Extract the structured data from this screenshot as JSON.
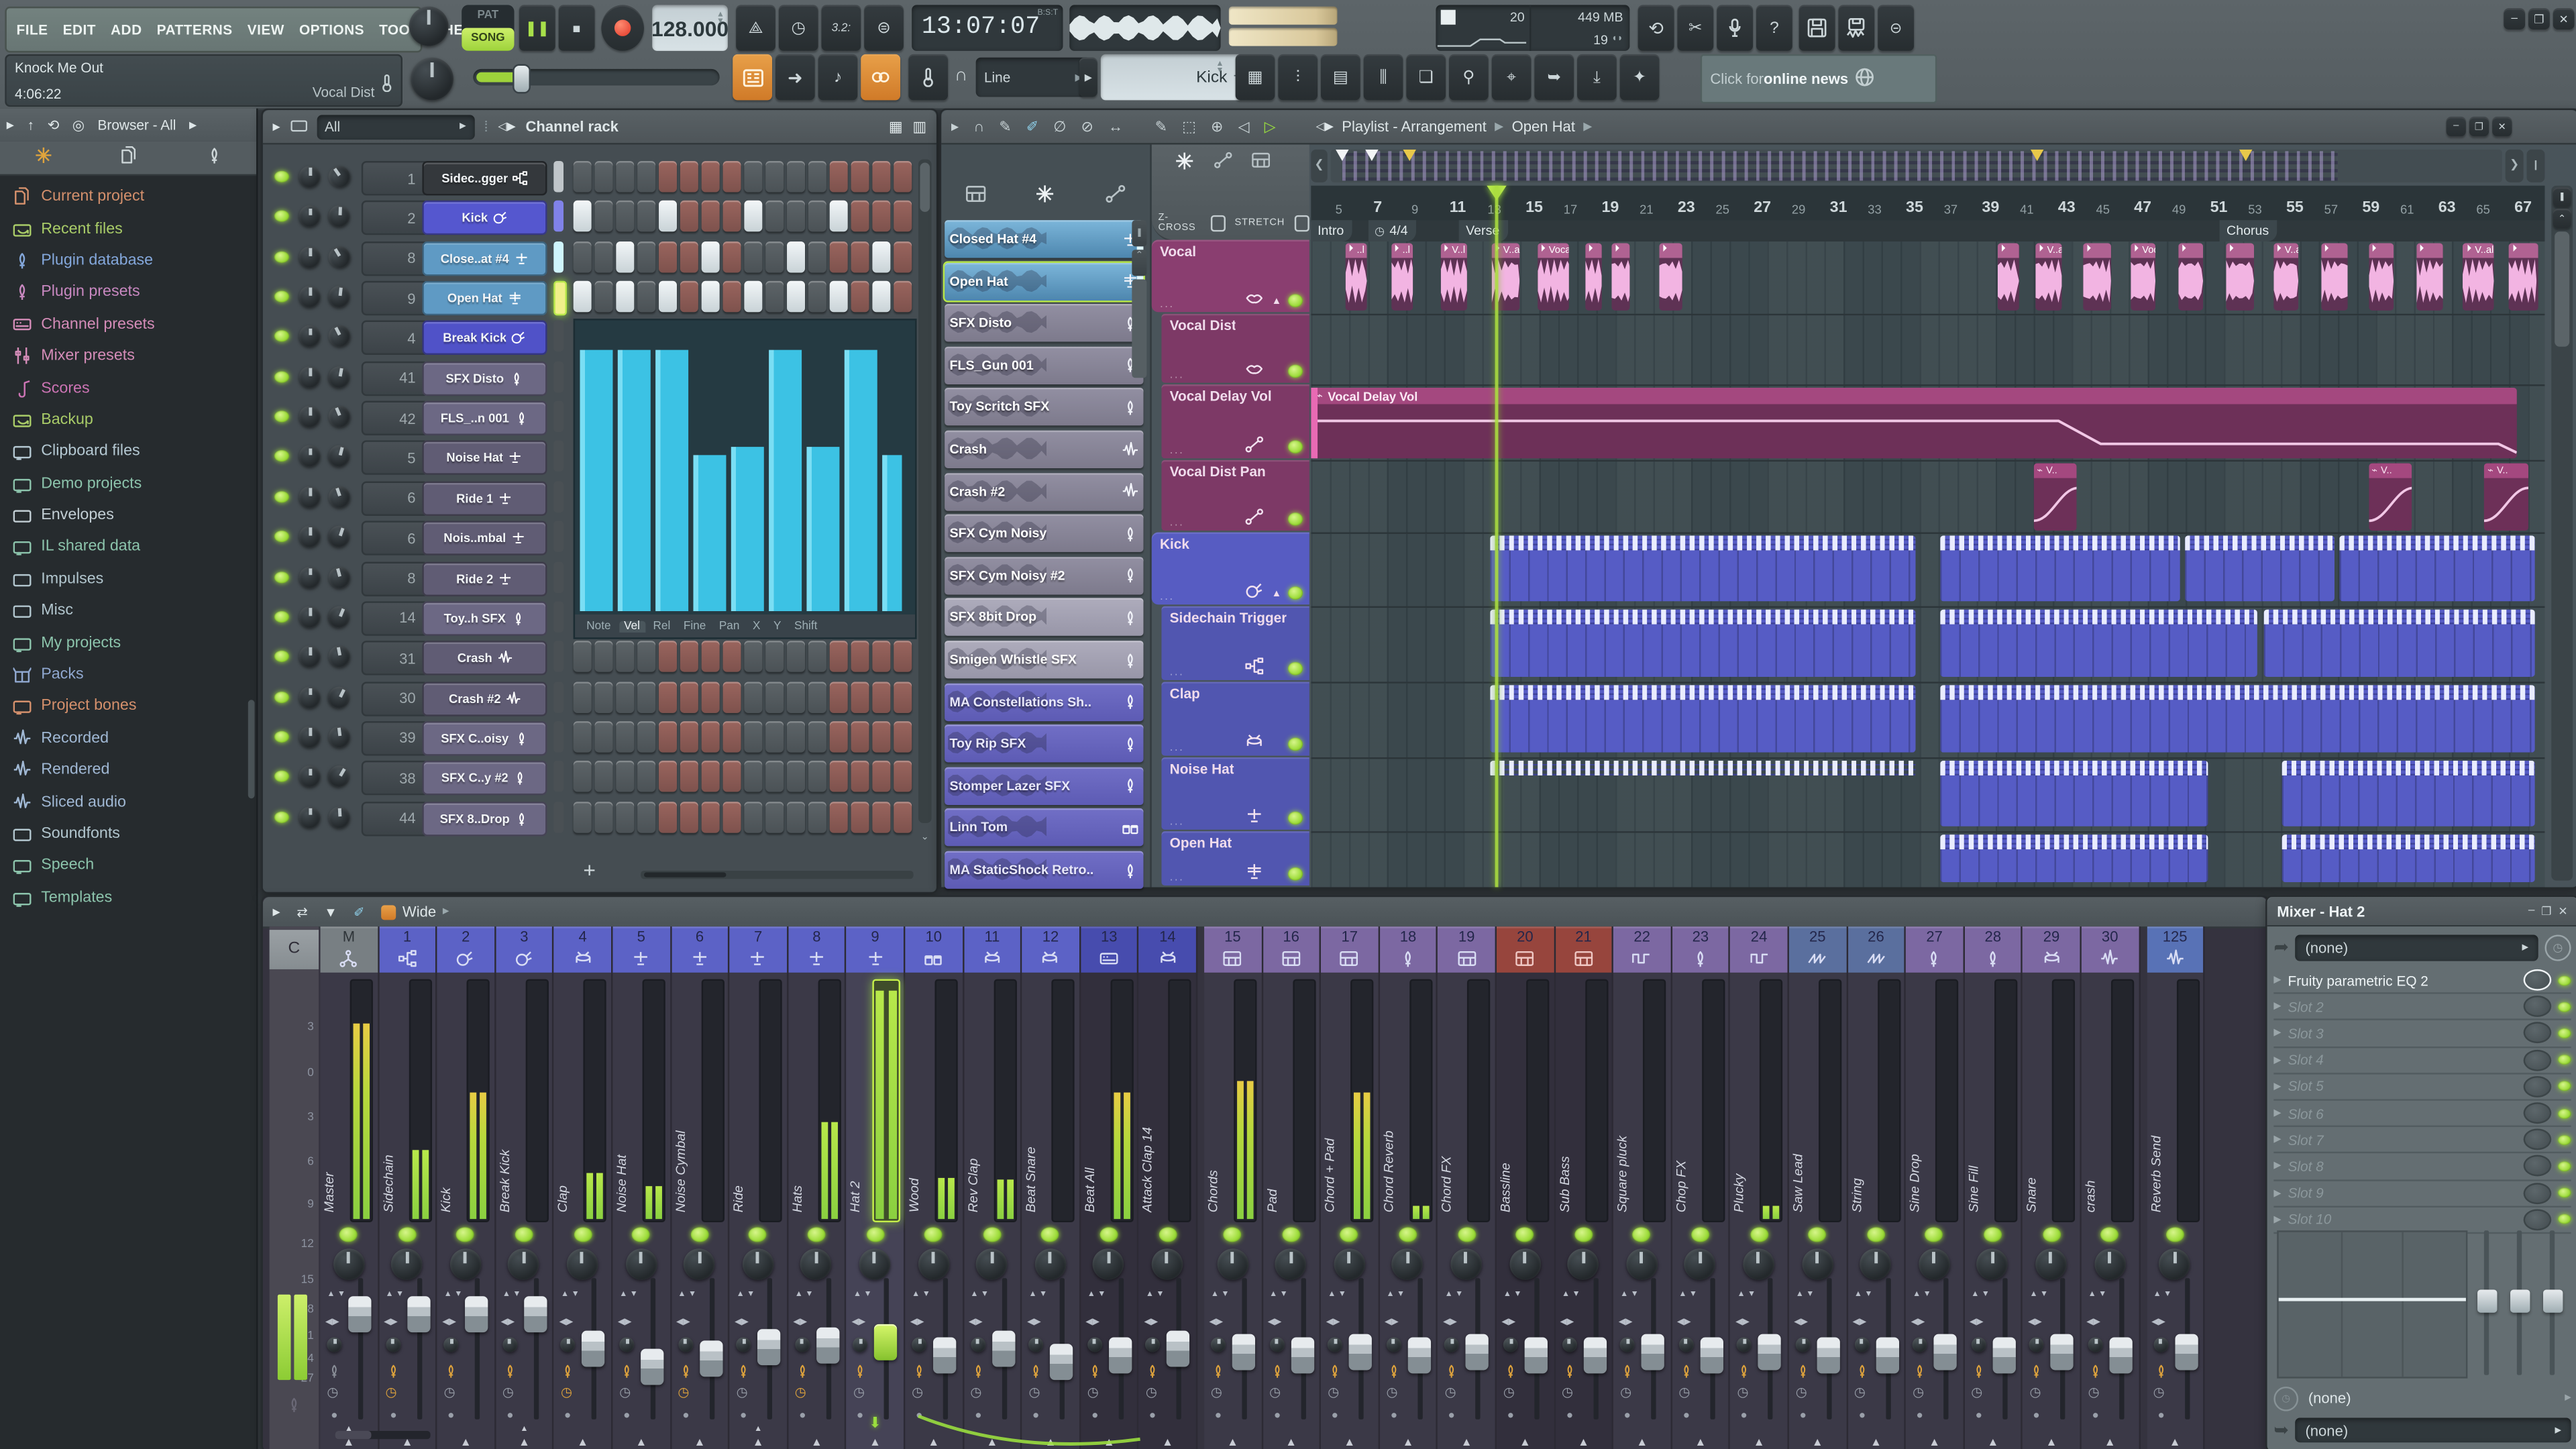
{
  "top": {
    "menu": [
      "FILE",
      "EDIT",
      "ADD",
      "PATTERNS",
      "VIEW",
      "OPTIONS",
      "TOOLS",
      "HELP"
    ],
    "transport": {
      "pat": "PAT",
      "song": "SONG",
      "bpm": "128.000",
      "time": "13:07:07",
      "time_mode": "B:S:T",
      "cpu_pct": "20",
      "mem": "449 MB",
      "polyphony": "19"
    },
    "project": {
      "name": "Knock Me Out",
      "time": "4:06:22",
      "focus": "Vocal Dist"
    },
    "snap": "Line",
    "pattern_selector": "Kick",
    "news_pre": "Click for ",
    "news_bold": "online news"
  },
  "browser": {
    "title": "Browser - All",
    "items": [
      {
        "label": "Current project",
        "icon": "docs",
        "color": "#d4906c"
      },
      {
        "label": "Recent files",
        "icon": "folderarrow",
        "color": "#a9cc68"
      },
      {
        "label": "Plugin database",
        "icon": "plug",
        "color": "#84a8dc"
      },
      {
        "label": "Plugin presets",
        "icon": "plug",
        "color": "#c888c0"
      },
      {
        "label": "Channel presets",
        "icon": "machine",
        "color": "#d48cb8"
      },
      {
        "label": "Mixer presets",
        "icon": "mix",
        "color": "#d48cb8"
      },
      {
        "label": "Scores",
        "icon": "note",
        "color": "#cc74b4"
      },
      {
        "label": "Backup",
        "icon": "folderarrow",
        "color": "#a9cc68"
      },
      {
        "label": "Clipboard files",
        "icon": "folderplus",
        "color": "#b4c8d2"
      },
      {
        "label": "Demo projects",
        "icon": "folderplus",
        "color": "#8cc4ac"
      },
      {
        "label": "Envelopes",
        "icon": "folder",
        "color": "#c2ced4"
      },
      {
        "label": "IL shared data",
        "icon": "folderplus",
        "color": "#8cc4ac"
      },
      {
        "label": "Impulses",
        "icon": "folder",
        "color": "#b2c6ce"
      },
      {
        "label": "Misc",
        "icon": "folder",
        "color": "#b2c6ce"
      },
      {
        "label": "My projects",
        "icon": "folderplus",
        "color": "#8cc4ac"
      },
      {
        "label": "Packs",
        "icon": "box",
        "color": "#90a8d0"
      },
      {
        "label": "Project bones",
        "icon": "folderplus",
        "color": "#d4906c"
      },
      {
        "label": "Recorded",
        "icon": "wave",
        "color": "#a0b8d4"
      },
      {
        "label": "Rendered",
        "icon": "wave",
        "color": "#a0b8d4"
      },
      {
        "label": "Sliced audio",
        "icon": "wave",
        "color": "#a0b8d4"
      },
      {
        "label": "Soundfonts",
        "icon": "folder",
        "color": "#b2c6ce"
      },
      {
        "label": "Speech",
        "icon": "folderplus",
        "color": "#8cc4ac"
      },
      {
        "label": "Templates",
        "icon": "folderplus",
        "color": "#8cc4ac"
      }
    ]
  },
  "rack": {
    "filter": "All",
    "title": "Channel rack",
    "add": "+",
    "channels": [
      {
        "num": "1",
        "name": "Sidec..gger",
        "bg": "#34383c",
        "icon": "sidechain",
        "sel": "#c0c6ca"
      },
      {
        "num": "2",
        "name": "Kick",
        "bg": "#5557cf",
        "icon": "kick",
        "sel": "#8082e8"
      },
      {
        "num": "8",
        "name": "Close..at #4",
        "bg": "#5f9ac4",
        "icon": "hat",
        "sel": "#cff4fc"
      },
      {
        "num": "9",
        "name": "Open Hat",
        "bg": "#5f9ac4",
        "icon": "hatopen",
        "sel": "#f0f08a",
        "selected": true
      },
      {
        "num": "4",
        "name": "Break Kick",
        "bg": "#5052c8",
        "icon": "kick",
        "sel": "#4a5054"
      },
      {
        "num": "41",
        "name": "SFX Disto",
        "bg": "#6c6884",
        "icon": "plug",
        "sel": "#4a5054"
      },
      {
        "num": "42",
        "name": "FLS_..n 001",
        "bg": "#6c6884",
        "icon": "plug",
        "sel": "#4a5054"
      },
      {
        "num": "5",
        "name": "Noise Hat",
        "bg": "#605c74",
        "icon": "hat",
        "sel": "#4a5054"
      },
      {
        "num": "6",
        "name": "Ride 1",
        "bg": "#605c74",
        "icon": "hat",
        "sel": "#4a5054"
      },
      {
        "num": "6",
        "name": "Nois..mbal",
        "bg": "#605c74",
        "icon": "hat",
        "sel": "#4a5054"
      },
      {
        "num": "8",
        "name": "Ride 2",
        "bg": "#605c74",
        "icon": "hat",
        "sel": "#4a5054"
      },
      {
        "num": "14",
        "name": "Toy..h SFX",
        "bg": "#6c6884",
        "icon": "plug",
        "sel": "#4a5054"
      },
      {
        "num": "31",
        "name": "Crash",
        "bg": "#605c74",
        "icon": "wave",
        "sel": "#4a5054"
      },
      {
        "num": "30",
        "name": "Crash #2",
        "bg": "#605c74",
        "icon": "wave",
        "sel": "#4a5054"
      },
      {
        "num": "39",
        "name": "SFX C..oisy",
        "bg": "#6c6884",
        "icon": "plug",
        "sel": "#4a5054"
      },
      {
        "num": "38",
        "name": "SFX C..y #2",
        "bg": "#6c6884",
        "icon": "plug",
        "sel": "#4a5054"
      },
      {
        "num": "44",
        "name": "SFX 8..Drop",
        "bg": "#6c6884",
        "icon": "plug",
        "sel": "#4a5054"
      }
    ],
    "steps_lit": {
      "1": [
        0,
        4,
        8,
        12
      ],
      "2": [
        2,
        6,
        10,
        14
      ],
      "3": [
        0,
        2,
        4,
        6,
        8,
        10,
        12,
        14
      ]
    },
    "graph": {
      "bars": [
        0.92,
        0.92,
        0.92,
        0.55,
        0.58,
        0.92,
        0.58,
        0.92,
        0.55
      ],
      "tabs": [
        "Note",
        "Vel",
        "Rel",
        "Fine",
        "Pan",
        "X",
        "Y",
        "Shift"
      ],
      "active_tab": "Vel"
    }
  },
  "picker": {
    "items": [
      {
        "name": "Closed Hat #4",
        "style": "blue",
        "icon": "hat"
      },
      {
        "name": "Open Hat",
        "style": "blue",
        "icon": "hatopen",
        "selected": true
      },
      {
        "name": "SFX Disto",
        "style": "gray",
        "icon": "plug"
      },
      {
        "name": "FLS_Gun 001",
        "style": "gray",
        "icon": "plug"
      },
      {
        "name": "Toy Scritch SFX",
        "style": "gray",
        "icon": "plug"
      },
      {
        "name": "Crash",
        "style": "gray",
        "icon": "wave"
      },
      {
        "name": "Crash #2",
        "style": "gray",
        "icon": "wave"
      },
      {
        "name": "SFX Cym Noisy",
        "style": "gray",
        "icon": "plug"
      },
      {
        "name": "SFX Cym Noisy #2",
        "style": "gray",
        "icon": "plug"
      },
      {
        "name": "SFX 8bit Drop",
        "style": "light",
        "icon": "plug"
      },
      {
        "name": "Smigen Whistle SFX",
        "style": "light",
        "icon": "plug"
      },
      {
        "name": "MA Constellations Sh..",
        "style": "purple",
        "icon": "plug"
      },
      {
        "name": "Toy Rip SFX",
        "style": "purple",
        "icon": "plug"
      },
      {
        "name": "Stomper Lazer SFX",
        "style": "purple",
        "icon": "plug"
      },
      {
        "name": "Linn Tom",
        "style": "purple",
        "icon": "toms"
      },
      {
        "name": "MA StaticShock Retro..",
        "style": "purple",
        "icon": "plug"
      }
    ]
  },
  "playlist": {
    "title": "Playlist - Arrangement",
    "crumb": "Open Hat",
    "toggle_zcross": "Z-CROSS",
    "toggle_stretch": "STRETCH",
    "ruler_start": 5,
    "ruler_end": 67,
    "playhead_bar": 13,
    "markers": [
      {
        "label": "Intro",
        "bar": 3.3
      },
      {
        "label": "4/4",
        "bar": 6.2,
        "clock": true
      },
      {
        "label": "Verse",
        "bar": 11
      },
      {
        "label": "Chorus",
        "bar": 51
      }
    ],
    "tracks": [
      {
        "name": "Vocal",
        "bg": "#8a3e70",
        "icon": "lips",
        "parent": true,
        "h": 45
      },
      {
        "name": "Vocal Dist",
        "bg": "#7d3966",
        "icon": "lips",
        "h": 43
      },
      {
        "name": "Vocal Delay Vol",
        "bg": "#7d3966",
        "icon": "auto",
        "h": 46
      },
      {
        "name": "Vocal Dist Pan",
        "bg": "#7d3966",
        "icon": "auto",
        "h": 44
      },
      {
        "name": "Kick",
        "bg": "#575cc2",
        "icon": "kick",
        "parent": true,
        "h": 45
      },
      {
        "name": "Sidechain Trigger",
        "bg": "#5156b0",
        "icon": "sidechain",
        "h": 46
      },
      {
        "name": "Clap",
        "bg": "#5156b0",
        "icon": "drum",
        "h": 46
      },
      {
        "name": "Noise Hat",
        "bg": "#5156b0",
        "icon": "hat",
        "h": 45
      },
      {
        "name": "Open Hat",
        "bg": "#5156b0",
        "icon": "hatopen",
        "h": 34
      }
    ],
    "vocal_clips": [
      {
        "b": 5.0,
        "w": 1.1,
        "l": "..l"
      },
      {
        "b": 7.4,
        "w": 1.2,
        "l": "..l"
      },
      {
        "b": 10.0,
        "w": 1.4,
        "l": "V..l"
      },
      {
        "b": 12.7,
        "w": 1.5,
        "l": "V..al"
      },
      {
        "b": 15.1,
        "w": 1.7,
        "l": "Vocal"
      },
      {
        "b": 17.6,
        "w": 0.9,
        "l": ""
      },
      {
        "b": 19.0,
        "w": 1.0,
        "l": ""
      },
      {
        "b": 21.5,
        "w": 1.2,
        "l": ""
      },
      {
        "b": 39.3,
        "w": 1.1,
        "l": ""
      },
      {
        "b": 41.3,
        "w": 1.4,
        "l": "V..al"
      },
      {
        "b": 43.8,
        "w": 1.5,
        "l": ""
      },
      {
        "b": 46.3,
        "w": 1.3,
        "l": "Vocal"
      },
      {
        "b": 48.8,
        "w": 1.3,
        "l": ""
      },
      {
        "b": 51.3,
        "w": 1.5,
        "l": ""
      },
      {
        "b": 53.8,
        "w": 1.3,
        "l": "V..al"
      },
      {
        "b": 56.3,
        "w": 1.4,
        "l": ""
      },
      {
        "b": 58.8,
        "w": 1.3,
        "l": ""
      },
      {
        "b": 61.3,
        "w": 1.4,
        "l": ""
      },
      {
        "b": 63.8,
        "w": 1.6,
        "l": "V..al"
      },
      {
        "b": 66.2,
        "w": 1.5,
        "l": ""
      }
    ],
    "automation_clip": {
      "label": "Vocal Delay Vol",
      "b0": 3.2,
      "b1": 66.6,
      "line": [
        [
          0,
          0.33
        ],
        [
          0.62,
          0.33
        ],
        [
          0.655,
          0.78
        ],
        [
          0.985,
          0.78
        ],
        [
          1,
          0.95
        ]
      ]
    },
    "pan_clips": [
      {
        "b": 41.2,
        "w": 2.3,
        "l": "V.."
      },
      {
        "b": 58.8,
        "w": 2.3,
        "l": "V.."
      },
      {
        "b": 64.9,
        "w": 2.3,
        "l": "V.."
      }
    ],
    "pattern_runs": {
      "kick": [
        [
          12.6,
          35.0
        ],
        [
          36.3,
          48.9
        ],
        [
          49.2,
          57.0
        ],
        [
          57.3,
          67.6
        ]
      ],
      "sidechain": [
        [
          12.6,
          35.0
        ],
        [
          36.3,
          53.0
        ],
        [
          53.3,
          67.6
        ]
      ],
      "clap": [
        [
          12.6,
          35.0
        ],
        [
          36.3,
          67.6
        ]
      ],
      "noisehat_ticks": [
        [
          12.6,
          35.0
        ]
      ],
      "noisehat": [
        [
          36.3,
          50.4
        ],
        [
          54.3,
          67.6
        ]
      ],
      "openhat": [
        [
          36.3,
          50.4
        ],
        [
          54.3,
          67.6
        ]
      ]
    }
  },
  "mixer": {
    "view": "Wide",
    "db_scale": [
      "3",
      "0",
      "3",
      "6",
      "9",
      "12",
      "15",
      "18",
      "21",
      "24",
      "27"
    ],
    "dock_label": "C",
    "strips": [
      {
        "num": "M",
        "name": "Master",
        "grp": "gray",
        "icon": "net",
        "meter": 0.85,
        "mcol": "yellow",
        "fader": 0.82,
        "route": true
      },
      {
        "num": "1",
        "name": "Sidechain",
        "grp": "blue",
        "icon": "sidechain",
        "meter": 0.3,
        "fader": 0.82
      },
      {
        "num": "2",
        "name": "Kick",
        "grp": "blue",
        "icon": "kick",
        "meter": 0.55,
        "mcol": "yellow",
        "fader": 0.82
      },
      {
        "num": "3",
        "name": "Break Kick",
        "grp": "blue",
        "icon": "kick",
        "meter": 0,
        "fader": 0.82,
        "route": true
      },
      {
        "num": "4",
        "name": "Clap",
        "grp": "blue",
        "icon": "drum",
        "meter": 0.2,
        "fader": 0.48
      },
      {
        "num": "5",
        "name": "Noise Hat",
        "grp": "blue",
        "icon": "hat",
        "meter": 0.14,
        "fader": 0.3
      },
      {
        "num": "6",
        "name": "Noise Cymbal",
        "grp": "blue",
        "icon": "hat",
        "meter": 0,
        "fader": 0.38
      },
      {
        "num": "7",
        "name": "Ride",
        "grp": "blue",
        "icon": "hat",
        "meter": 0,
        "fader": 0.5,
        "route": true
      },
      {
        "num": "8",
        "name": "Hats",
        "grp": "blue",
        "icon": "hat",
        "meter": 0.42,
        "fader": 0.52
      },
      {
        "num": "9",
        "name": "Hat 2",
        "grp": "blue",
        "icon": "hat",
        "meter": 1,
        "fader": 0.55,
        "selected": true
      },
      {
        "num": "10",
        "name": "Wood",
        "grp": "blue",
        "icon": "toms",
        "meter": 0.18,
        "fader": 0.42
      },
      {
        "num": "11",
        "name": "Rev Clap",
        "grp": "blue",
        "icon": "drum",
        "meter": 0.17,
        "fader": 0.48
      },
      {
        "num": "12",
        "name": "Beat Snare",
        "grp": "blue",
        "icon": "drum",
        "meter": 0,
        "fader": 0.36
      },
      {
        "num": "13",
        "name": "Beat All",
        "grp": "darkblue",
        "icon": "machine",
        "meter": 0.55,
        "mcol": "yellow",
        "fader": 0.42
      },
      {
        "num": "14",
        "name": "Attack Clap 14",
        "grp": "darkblue",
        "icon": "drum",
        "meter": 0,
        "fader": 0.48
      },
      {
        "num": "15",
        "name": "Chords",
        "grp": "purple",
        "icon": "piano",
        "meter": 0.6,
        "mcol": "yellow",
        "fader": 0.45,
        "gapBefore": true
      },
      {
        "num": "16",
        "name": "Pad",
        "grp": "purple",
        "icon": "piano",
        "meter": 0,
        "fader": 0.42
      },
      {
        "num": "17",
        "name": "Chord + Pad",
        "grp": "purple",
        "icon": "piano",
        "meter": 0.55,
        "mcol": "yellow",
        "fader": 0.45
      },
      {
        "num": "18",
        "name": "Chord Reverb",
        "grp": "purple",
        "icon": "plug",
        "meter": 0.06,
        "fader": 0.42
      },
      {
        "num": "19",
        "name": "Chord FX",
        "grp": "purple",
        "icon": "piano",
        "meter": 0,
        "fader": 0.45
      },
      {
        "num": "20",
        "name": "Bassline",
        "grp": "red",
        "icon": "piano",
        "meter": 0,
        "fader": 0.42
      },
      {
        "num": "21",
        "name": "Sub Bass",
        "grp": "red",
        "icon": "piano",
        "meter": 0,
        "fader": 0.42
      },
      {
        "num": "22",
        "name": "Square pluck",
        "grp": "purple",
        "icon": "square",
        "meter": 0,
        "fader": 0.45
      },
      {
        "num": "23",
        "name": "Chop FX",
        "grp": "purple",
        "icon": "plug",
        "meter": 0,
        "fader": 0.42
      },
      {
        "num": "24",
        "name": "Plucky",
        "grp": "purple",
        "icon": "square",
        "meter": 0.06,
        "fader": 0.45
      },
      {
        "num": "25",
        "name": "Saw Lead",
        "grp": "steel",
        "icon": "saw",
        "meter": 0,
        "fader": 0.42
      },
      {
        "num": "26",
        "name": "String",
        "grp": "steel",
        "icon": "saw",
        "meter": 0,
        "fader": 0.42
      },
      {
        "num": "27",
        "name": "Sine Drop",
        "grp": "purple",
        "icon": "plug",
        "meter": 0,
        "fader": 0.45
      },
      {
        "num": "28",
        "name": "Sine Fill",
        "grp": "purple",
        "icon": "plug",
        "meter": 0,
        "fader": 0.42
      },
      {
        "num": "29",
        "name": "Snare",
        "grp": "purple",
        "icon": "drum",
        "meter": 0,
        "fader": 0.45
      },
      {
        "num": "30",
        "name": "crash",
        "grp": "purple",
        "icon": "wave",
        "meter": 0,
        "fader": 0.42
      },
      {
        "num": "125",
        "name": "Reverb Send",
        "grp": "send",
        "icon": "wave",
        "meter": 0,
        "fader": 0.45,
        "gapBefore": true
      }
    ],
    "grp_colors": {
      "blue": "#5c62c6",
      "darkblue": "#474cae",
      "purple": "#7c68a2",
      "red": "#97453d",
      "steel": "#5a6f9e",
      "send": "#5872b6",
      "gray": "#787f83"
    }
  },
  "fx": {
    "title": "Mixer - Hat 2",
    "input": "(none)",
    "mid": "(none)",
    "out": "(none)",
    "slots": [
      {
        "name": "Fruity parametric EQ 2",
        "active": true
      },
      {
        "name": "Slot 2"
      },
      {
        "name": "Slot 3"
      },
      {
        "name": "Slot 4"
      },
      {
        "name": "Slot 5"
      },
      {
        "name": "Slot 6"
      },
      {
        "name": "Slot 7"
      },
      {
        "name": "Slot 8"
      },
      {
        "name": "Slot 9"
      },
      {
        "name": "Slot 10"
      }
    ]
  }
}
